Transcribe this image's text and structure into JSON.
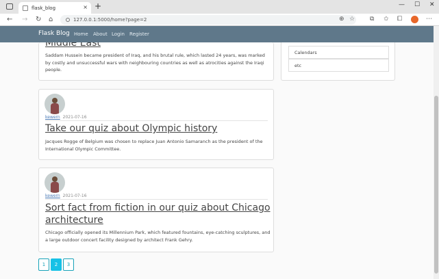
{
  "browser": {
    "tab_title": "flask_blog",
    "url": "127.0.0.1:5000/home?page=2"
  },
  "nav": {
    "brand": "Flask Blog",
    "links": [
      "Home",
      "About",
      "Login",
      "Register"
    ]
  },
  "posts": [
    {
      "title": "Middle East",
      "excerpt": "Saddam Hussein became president of Iraq, and his brutal rule, which lasted 24 years, was marked by costly and unsuccessful wars with neighbouring countries as well as atrocities against the Iraqi people."
    },
    {
      "author": "kewern",
      "date": "2021-07-16",
      "title": "Take our quiz about Olympic history",
      "excerpt": "Jacques Rogge of Belgium was chosen to replace Juan Antonio Samaranch as the president of the International Olympic Committee."
    },
    {
      "author": "kewern",
      "date": "2021-07-16",
      "title": "Sort fact from fiction in our quiz about Chicago architecture",
      "excerpt": "Chicago officially opened its Millennium Park, which featured fountains, eye-catching sculptures, and a large outdoor concert facility designed by architect Frank Gehry."
    }
  ],
  "sidebar": {
    "items": [
      "Calendars",
      "etc"
    ]
  },
  "pagination": {
    "pages": [
      "1",
      "2",
      "3"
    ],
    "current": "2"
  }
}
